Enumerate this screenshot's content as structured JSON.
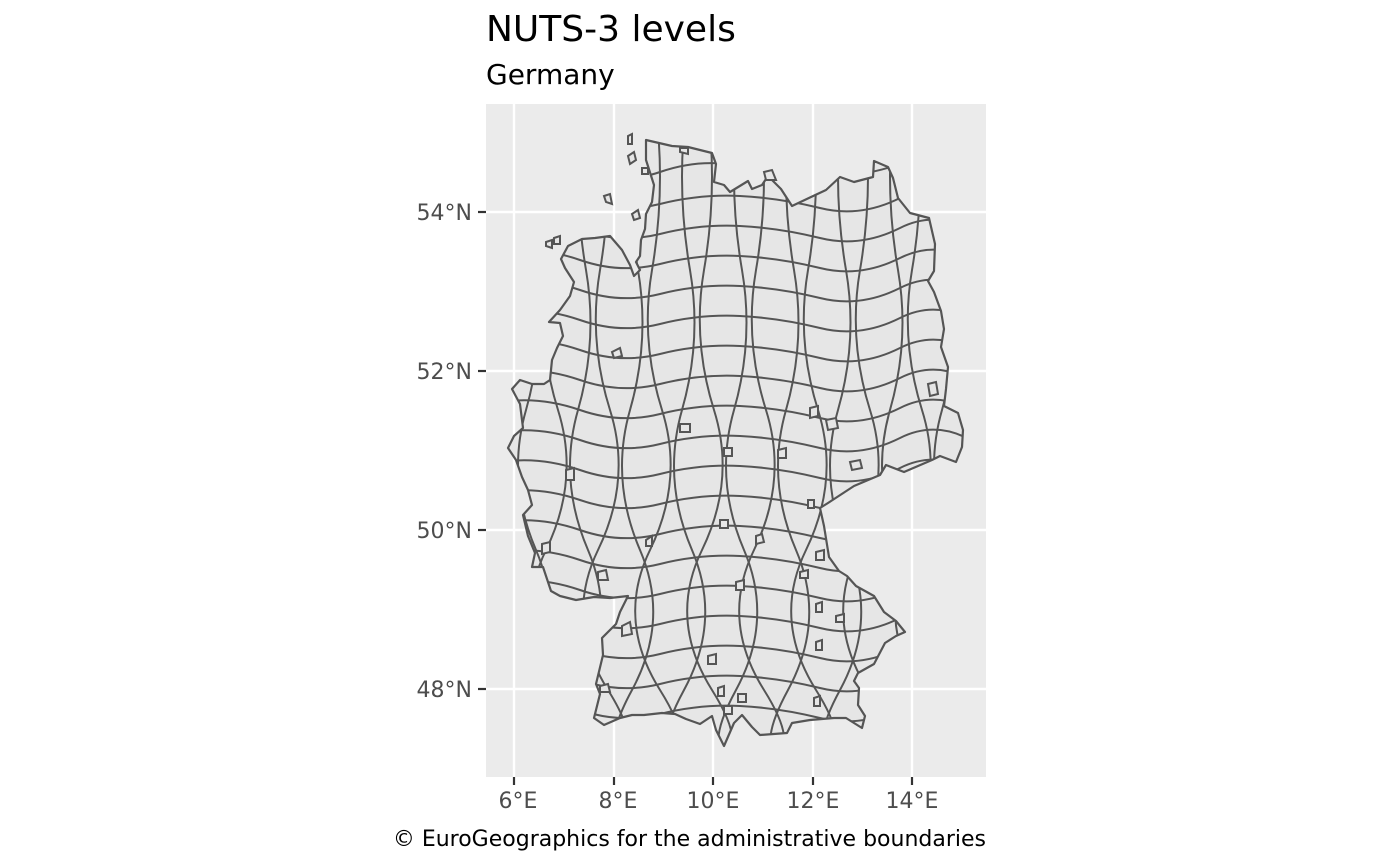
{
  "title": "NUTS-3 levels",
  "subtitle": "Germany",
  "caption": "© EuroGeographics for the administrative boundaries",
  "axes": {
    "x_ticks": [
      "6°E",
      "8°E",
      "10°E",
      "12°E",
      "14°E"
    ],
    "y_ticks": [
      "54°N",
      "52°N",
      "50°N",
      "48°N"
    ],
    "x_range_deg": [
      5.5,
      15.5
    ],
    "y_range_deg": [
      47.0,
      55.5
    ],
    "grid": true
  },
  "map": {
    "country": "Germany",
    "level": "NUTS-3",
    "colors": {
      "panel_background": "#ebebeb",
      "gridline": "#ffffff",
      "region_fill": "#e6e6e6",
      "region_border": "#555555"
    }
  }
}
